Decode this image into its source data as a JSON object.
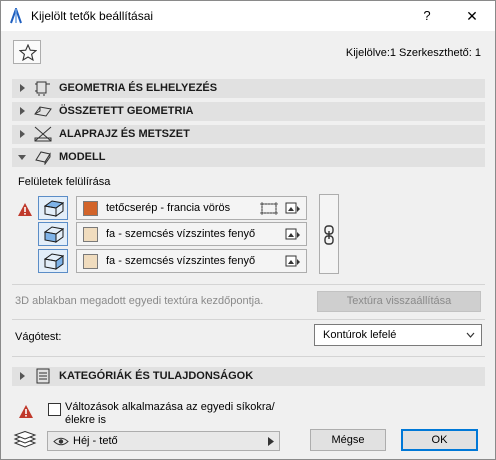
{
  "window": {
    "title": "Kijelölt tetők beállításai",
    "help_label": "?",
    "close_label": "✕"
  },
  "selection_info": "Kijelölve:1 Szerkeszthető: 1",
  "sections": [
    {
      "label": "GEOMETRIA ÉS ELHELYEZÉS",
      "icon": "geometry-icon",
      "expanded": false
    },
    {
      "label": "ÖSSZETETT GEOMETRIA",
      "icon": "complex-geometry-icon",
      "expanded": false
    },
    {
      "label": "ALAPRAJZ ÉS METSZET",
      "icon": "floor-plan-section-icon",
      "expanded": false
    },
    {
      "label": "MODELL",
      "icon": "model-icon",
      "expanded": true
    }
  ],
  "model": {
    "surfaces_label": "Felületek felülírása",
    "materials": [
      {
        "name": "tetőcserép - francia vörös",
        "color": "#d2642a",
        "has_texture_icon": true
      },
      {
        "name": "fa - szemcsés vízszintes fenyő",
        "color": "#f0dcbe",
        "has_texture_icon": false
      },
      {
        "name": "fa - szemcsés vízszintes fenyő",
        "color": "#f0dcbe",
        "has_texture_icon": false
      }
    ],
    "texture_label": "3D ablakban megadott egyedi textúra kezdőpontja.",
    "texture_button": "Textúra visszaállítása",
    "cut_label": "Vágótest:",
    "cut_value": "Kontúrok lefelé"
  },
  "category_section": {
    "label": "KATEGÓRIÁK ÉS TULAJDONSÁGOK",
    "icon": "list-icon",
    "expanded": false
  },
  "footer": {
    "apply_checkbox_label": "Változások alkalmazása az egyedi síkokra/élekre is",
    "apply_checked": false,
    "layer_value": "Héj - tető",
    "cancel_label": "Mégse",
    "ok_label": "OK"
  },
  "colors": {
    "accent": "#0078d7",
    "warning": "#c0392b",
    "section_bg": "#e1e1e1"
  }
}
